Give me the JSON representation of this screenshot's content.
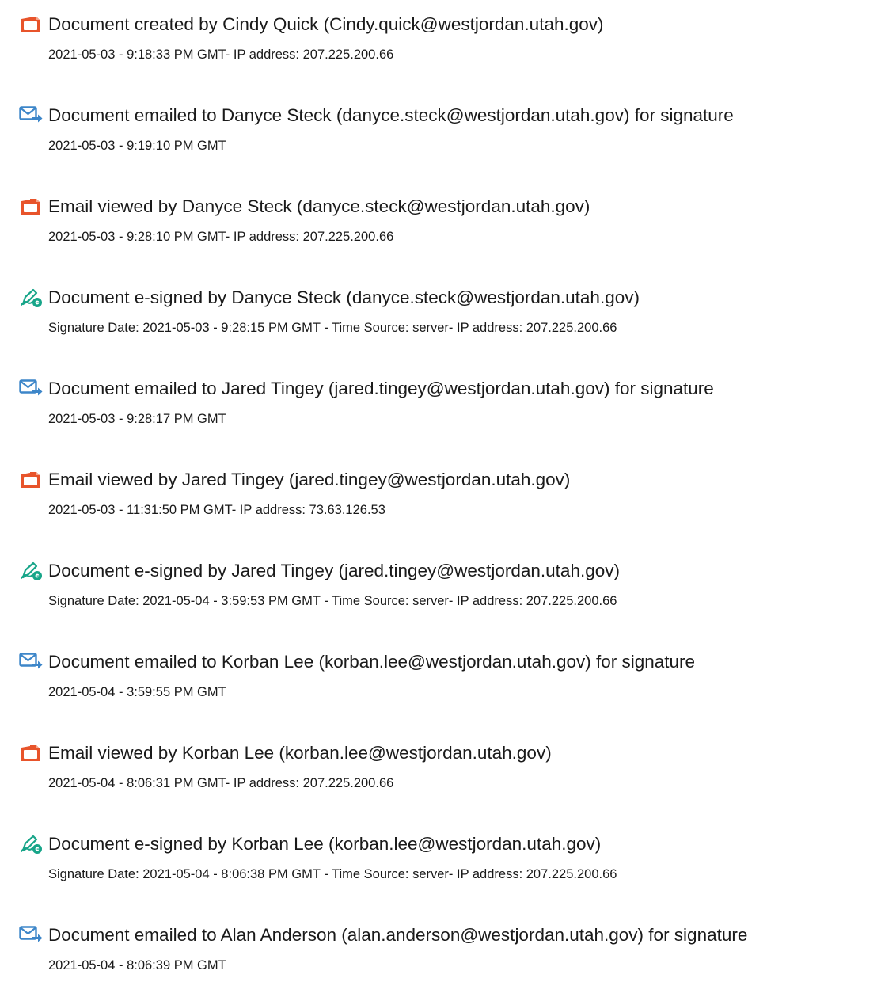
{
  "colors": {
    "created_icon": "#e8542b",
    "emailed_icon": "#3d86c9",
    "signed_icon": "#17a589",
    "text": "#1a1a1a"
  },
  "events": [
    {
      "icon": "document-icon",
      "title": "Document created by Cindy Quick (Cindy.quick@westjordan.utah.gov)",
      "detail": "2021-05-03 - 9:18:33 PM GMT- IP address: 207.225.200.66"
    },
    {
      "icon": "email-icon",
      "title": "Document emailed to Danyce Steck (danyce.steck@westjordan.utah.gov) for signature",
      "detail": "2021-05-03 - 9:19:10 PM GMT"
    },
    {
      "icon": "document-icon",
      "title": "Email viewed by Danyce Steck (danyce.steck@westjordan.utah.gov)",
      "detail": "2021-05-03 - 9:28:10 PM GMT- IP address: 207.225.200.66"
    },
    {
      "icon": "esign-icon",
      "title": "Document e-signed by Danyce Steck (danyce.steck@westjordan.utah.gov)",
      "detail": "Signature Date: 2021-05-03 - 9:28:15 PM GMT - Time Source: server- IP address: 207.225.200.66"
    },
    {
      "icon": "email-icon",
      "title": "Document emailed to Jared Tingey (jared.tingey@westjordan.utah.gov) for signature",
      "detail": "2021-05-03 - 9:28:17 PM GMT"
    },
    {
      "icon": "document-icon",
      "title": "Email viewed by Jared Tingey (jared.tingey@westjordan.utah.gov)",
      "detail": "2021-05-03 - 11:31:50 PM GMT- IP address: 73.63.126.53"
    },
    {
      "icon": "esign-icon",
      "title": "Document e-signed by Jared Tingey (jared.tingey@westjordan.utah.gov)",
      "detail": "Signature Date: 2021-05-04 - 3:59:53 PM GMT - Time Source: server- IP address: 207.225.200.66"
    },
    {
      "icon": "email-icon",
      "title": "Document emailed to Korban Lee (korban.lee@westjordan.utah.gov) for signature",
      "detail": "2021-05-04 - 3:59:55 PM GMT"
    },
    {
      "icon": "document-icon",
      "title": "Email viewed by Korban Lee (korban.lee@westjordan.utah.gov)",
      "detail": "2021-05-04 - 8:06:31 PM GMT- IP address: 207.225.200.66"
    },
    {
      "icon": "esign-icon",
      "title": "Document e-signed by Korban Lee (korban.lee@westjordan.utah.gov)",
      "detail": "Signature Date: 2021-05-04 - 8:06:38 PM GMT - Time Source: server- IP address: 207.225.200.66"
    },
    {
      "icon": "email-icon",
      "title": "Document emailed to Alan Anderson (alan.anderson@westjordan.utah.gov) for signature",
      "detail": "2021-05-04 - 8:06:39 PM GMT"
    }
  ]
}
